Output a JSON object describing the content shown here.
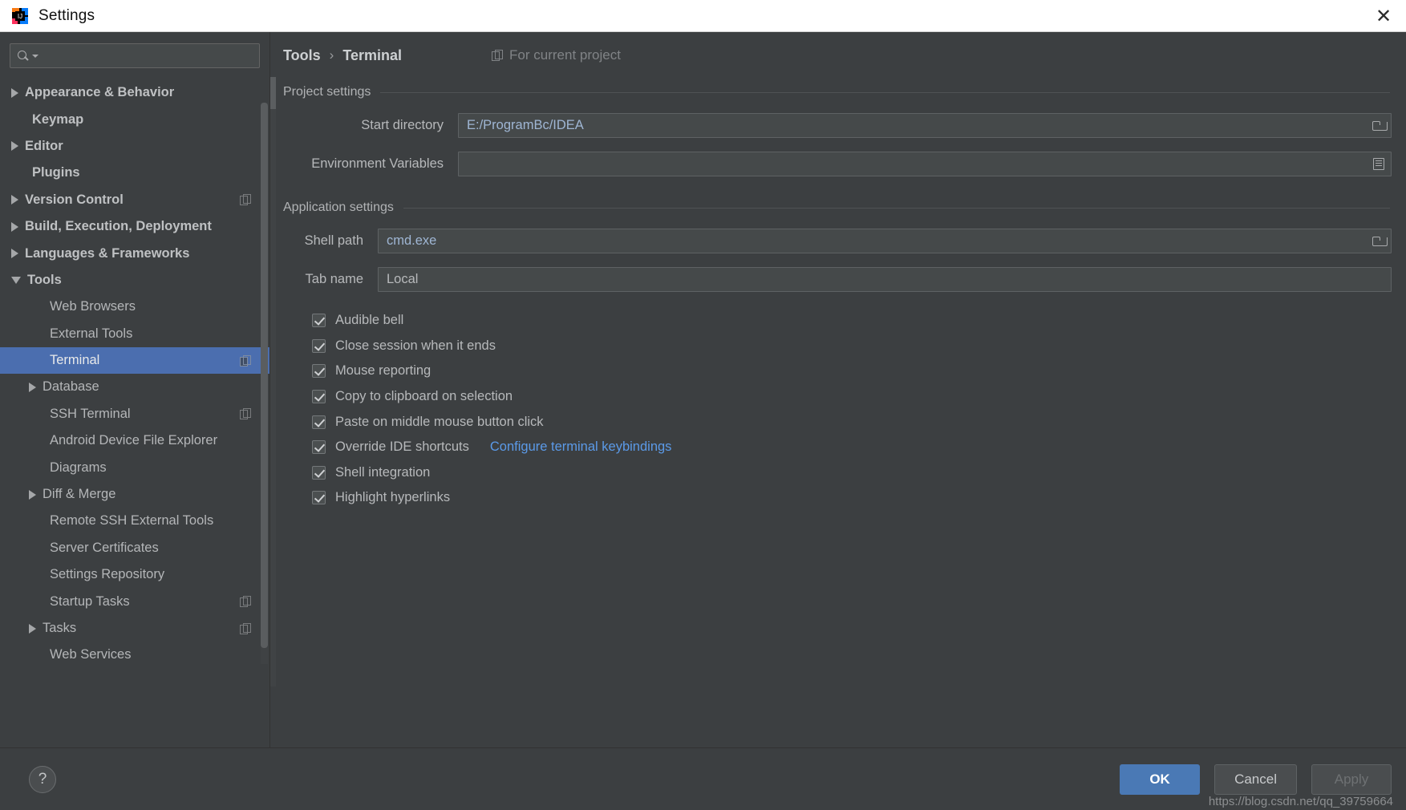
{
  "window": {
    "title": "Settings",
    "logo_icon": "intellij-idea-logo",
    "close_icon": "close-icon"
  },
  "sidebar": {
    "search": {
      "placeholder": "",
      "value": "",
      "icon": "search-icon",
      "caret_icon": "chevron-down-icon"
    },
    "items": [
      {
        "label": "Appearance & Behavior",
        "level": 0,
        "arrow": "right",
        "bold": true,
        "selected": false,
        "copy": false
      },
      {
        "label": "Keymap",
        "level": 0,
        "arrow": "none",
        "bold": true,
        "selected": false,
        "copy": false
      },
      {
        "label": "Editor",
        "level": 0,
        "arrow": "right",
        "bold": true,
        "selected": false,
        "copy": false
      },
      {
        "label": "Plugins",
        "level": 0,
        "arrow": "none",
        "bold": true,
        "selected": false,
        "copy": false
      },
      {
        "label": "Version Control",
        "level": 0,
        "arrow": "right",
        "bold": true,
        "selected": false,
        "copy": true
      },
      {
        "label": "Build, Execution, Deployment",
        "level": 0,
        "arrow": "right",
        "bold": true,
        "selected": false,
        "copy": false
      },
      {
        "label": "Languages & Frameworks",
        "level": 0,
        "arrow": "right",
        "bold": true,
        "selected": false,
        "copy": false
      },
      {
        "label": "Tools",
        "level": 0,
        "arrow": "down",
        "bold": true,
        "selected": false,
        "copy": false
      },
      {
        "label": "Web Browsers",
        "level": 1,
        "arrow": "none",
        "bold": false,
        "selected": false,
        "copy": false
      },
      {
        "label": "External Tools",
        "level": 1,
        "arrow": "none",
        "bold": false,
        "selected": false,
        "copy": false
      },
      {
        "label": "Terminal",
        "level": 1,
        "arrow": "none",
        "bold": false,
        "selected": true,
        "copy": true
      },
      {
        "label": "Database",
        "level": 1,
        "arrow": "right",
        "bold": false,
        "selected": false,
        "copy": false
      },
      {
        "label": "SSH Terminal",
        "level": 1,
        "arrow": "none",
        "bold": false,
        "selected": false,
        "copy": true
      },
      {
        "label": "Android Device File Explorer",
        "level": 1,
        "arrow": "none",
        "bold": false,
        "selected": false,
        "copy": false
      },
      {
        "label": "Diagrams",
        "level": 1,
        "arrow": "none",
        "bold": false,
        "selected": false,
        "copy": false
      },
      {
        "label": "Diff & Merge",
        "level": 1,
        "arrow": "right",
        "bold": false,
        "selected": false,
        "copy": false
      },
      {
        "label": "Remote SSH External Tools",
        "level": 1,
        "arrow": "none",
        "bold": false,
        "selected": false,
        "copy": false
      },
      {
        "label": "Server Certificates",
        "level": 1,
        "arrow": "none",
        "bold": false,
        "selected": false,
        "copy": false
      },
      {
        "label": "Settings Repository",
        "level": 1,
        "arrow": "none",
        "bold": false,
        "selected": false,
        "copy": false
      },
      {
        "label": "Startup Tasks",
        "level": 1,
        "arrow": "none",
        "bold": false,
        "selected": false,
        "copy": true
      },
      {
        "label": "Tasks",
        "level": 1,
        "arrow": "right",
        "bold": false,
        "selected": false,
        "copy": true
      },
      {
        "label": "Web Services",
        "level": 1,
        "arrow": "none",
        "bold": false,
        "selected": false,
        "copy": false
      }
    ]
  },
  "main": {
    "breadcrumb": {
      "parent": "Tools",
      "separator": "›",
      "current": "Terminal"
    },
    "scope": {
      "label": "For current project",
      "icon": "copy-icon"
    },
    "project_settings": {
      "title": "Project settings",
      "start_directory": {
        "label": "Start directory",
        "value": "E:/ProgramBc/IDEA",
        "button_icon": "folder-icon"
      },
      "environment_variables": {
        "label": "Environment Variables",
        "value": "",
        "button_icon": "list-icon"
      }
    },
    "application_settings": {
      "title": "Application settings",
      "shell_path": {
        "label": "Shell path",
        "value": "cmd.exe",
        "button_icon": "folder-icon"
      },
      "tab_name": {
        "label": "Tab name",
        "value": "Local"
      },
      "checkboxes": [
        {
          "label": "Audible bell",
          "checked": true
        },
        {
          "label": "Close session when it ends",
          "checked": true
        },
        {
          "label": "Mouse reporting",
          "checked": true
        },
        {
          "label": "Copy to clipboard on selection",
          "checked": true
        },
        {
          "label": "Paste on middle mouse button click",
          "checked": true
        },
        {
          "label": "Override IDE shortcuts",
          "checked": true,
          "link": "Configure terminal keybindings"
        },
        {
          "label": "Shell integration",
          "checked": true
        },
        {
          "label": "Highlight hyperlinks",
          "checked": true
        }
      ]
    }
  },
  "footer": {
    "help_label": "?",
    "ok_label": "OK",
    "cancel_label": "Cancel",
    "apply_label": "Apply",
    "watermark": "https://blog.csdn.net/qq_39759664"
  },
  "colors": {
    "accent": "#4b6eaf",
    "primary_button": "#4a79b5",
    "link": "#5b9ae8",
    "value_text": "#9fb6d4",
    "background": "#3c3f41"
  }
}
